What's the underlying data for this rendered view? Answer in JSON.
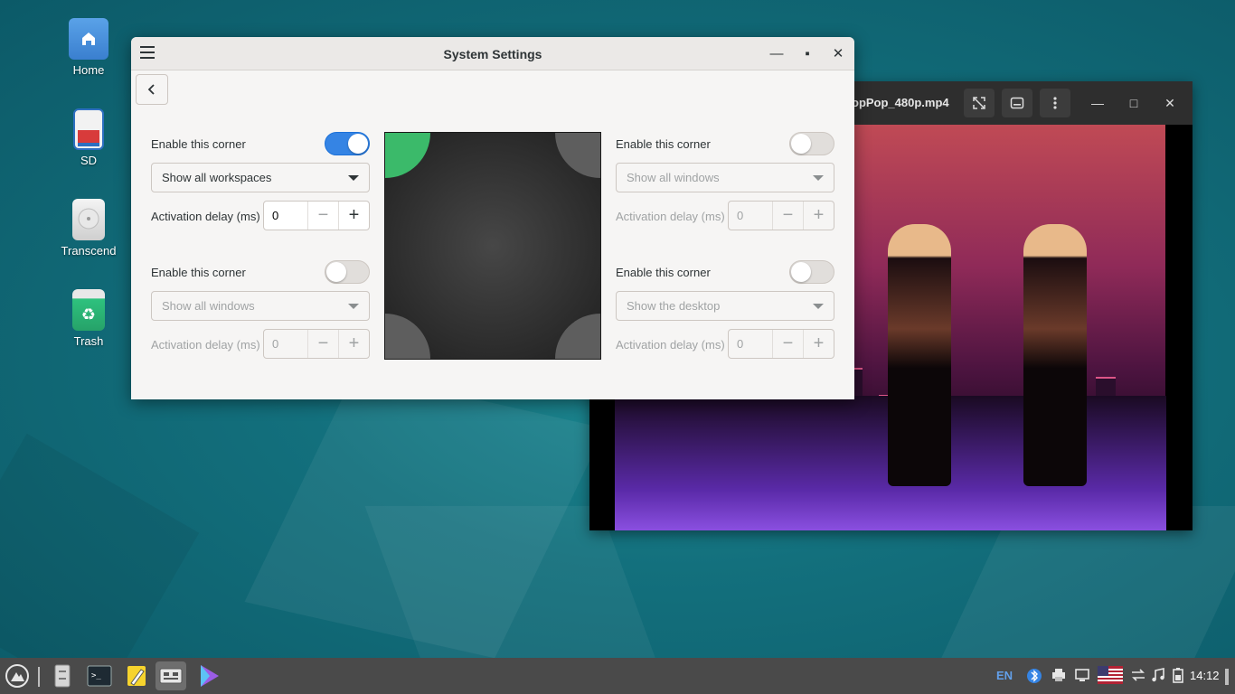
{
  "desktop": {
    "icons": [
      {
        "label": "Home",
        "icon": "folder-home-icon"
      },
      {
        "label": "SD",
        "icon": "sd-card-icon"
      },
      {
        "label": "Transcend",
        "icon": "drive-icon"
      },
      {
        "label": "Trash",
        "icon": "trash-icon"
      }
    ]
  },
  "video_window": {
    "title": "opPop_480p.mp4"
  },
  "settings": {
    "title": "System Settings",
    "corners": [
      {
        "enable_label": "Enable this corner",
        "enabled": true,
        "action": "Show all workspaces",
        "delay_label": "Activation delay (ms)",
        "delay_value": "0"
      },
      {
        "enable_label": "Enable this corner",
        "enabled": false,
        "action": "Show all windows",
        "delay_label": "Activation delay (ms)",
        "delay_value": "0"
      },
      {
        "enable_label": "Enable this corner",
        "enabled": false,
        "action": "Show all windows",
        "delay_label": "Activation delay (ms)",
        "delay_value": "0"
      },
      {
        "enable_label": "Enable this corner",
        "enabled": false,
        "action": "Show the desktop",
        "delay_label": "Activation delay (ms)",
        "delay_value": "0"
      }
    ],
    "colors": {
      "accent": "#3584e4",
      "active_corner": "#3bba6a",
      "inactive_corner": "#5e5e5e"
    }
  },
  "taskbar": {
    "lang": "EN",
    "clock": "14:12"
  }
}
